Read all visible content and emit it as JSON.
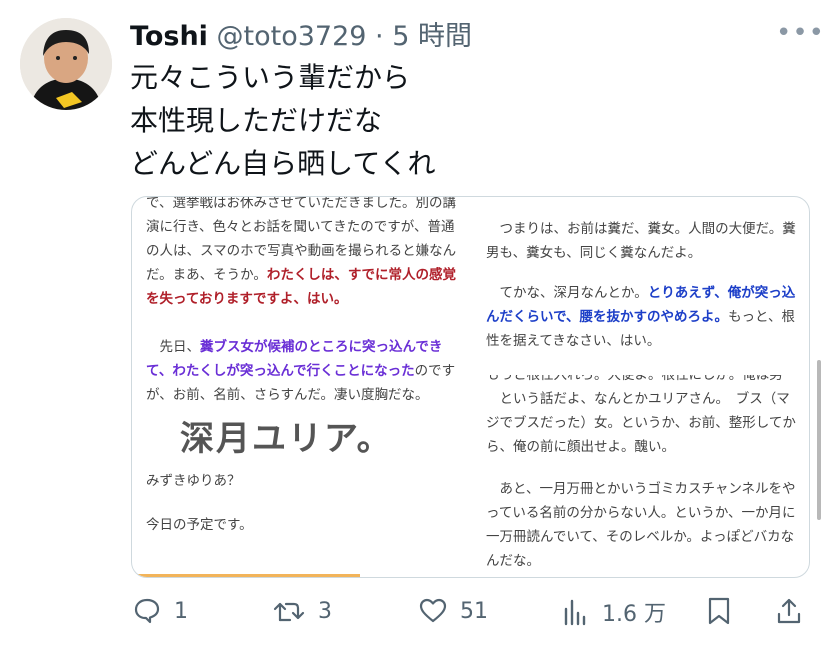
{
  "tweet": {
    "name": "Toshi",
    "meta": "@toto3729 · 5 時間",
    "more_icon": "more-icon",
    "lines": [
      "元々こういう輩だから",
      "本性現しただけだな",
      "どんどん自ら晒してくれ"
    ]
  },
  "card": {
    "left_col": {
      "p1_a": "で、選挙戦はお休みさせていただきました。別の講演に行き、色々とお話を聞いてきたのですが、普通の人は、スマのホで写真や動画を撮られると嫌なんだ。まあ、そうか。",
      "p1_red": "わたくしは、すでに常人の感覚を失っておりますですよ、はい。",
      "p2_a": "先日、",
      "p2_purple": "糞ブス女が候補のところに突っ込んできて、わたくしが突っ込んで行くことになった",
      "p2_b": "のですが、お前、名前、さらすんだ。凄い度胸だな。",
      "big": "深月ユリア。",
      "p3": "みずきゆりあ？",
      "p4": "今日の予定です。"
    },
    "right_col": {
      "p1": "つまりは、お前は糞だ、糞女。人間の大便だ。糞男も、糞女も、同じく糞なんだよ。",
      "p2_a": "てかな、深月なんとか。",
      "p2_blue": "とりあえず、俺が突っ込んだくらいで、腰を抜かすのやめろよ。",
      "p2_b": "もっと、根性を据えてきなさい、はい。",
      "cut": "もっと根性入れろ。大便よ。根性にしか。俺は男",
      "p3": "という話だよ、なんとかユリアさん。　ブス（マジでブスだった）女。というか、お前、整形してから、俺の前に顔出せよ。醜い。",
      "p4": "あと、一月万冊とかいうゴミカスチャンネルをやっている名前の分からない人。というか、一か月に一万冊読んでいて、そのレベルか。よっぽどバカなんだな。"
    }
  },
  "actions": {
    "reply_count": "1",
    "retweet_count": "3",
    "like_count": "51",
    "views_count": "1.6 万"
  }
}
